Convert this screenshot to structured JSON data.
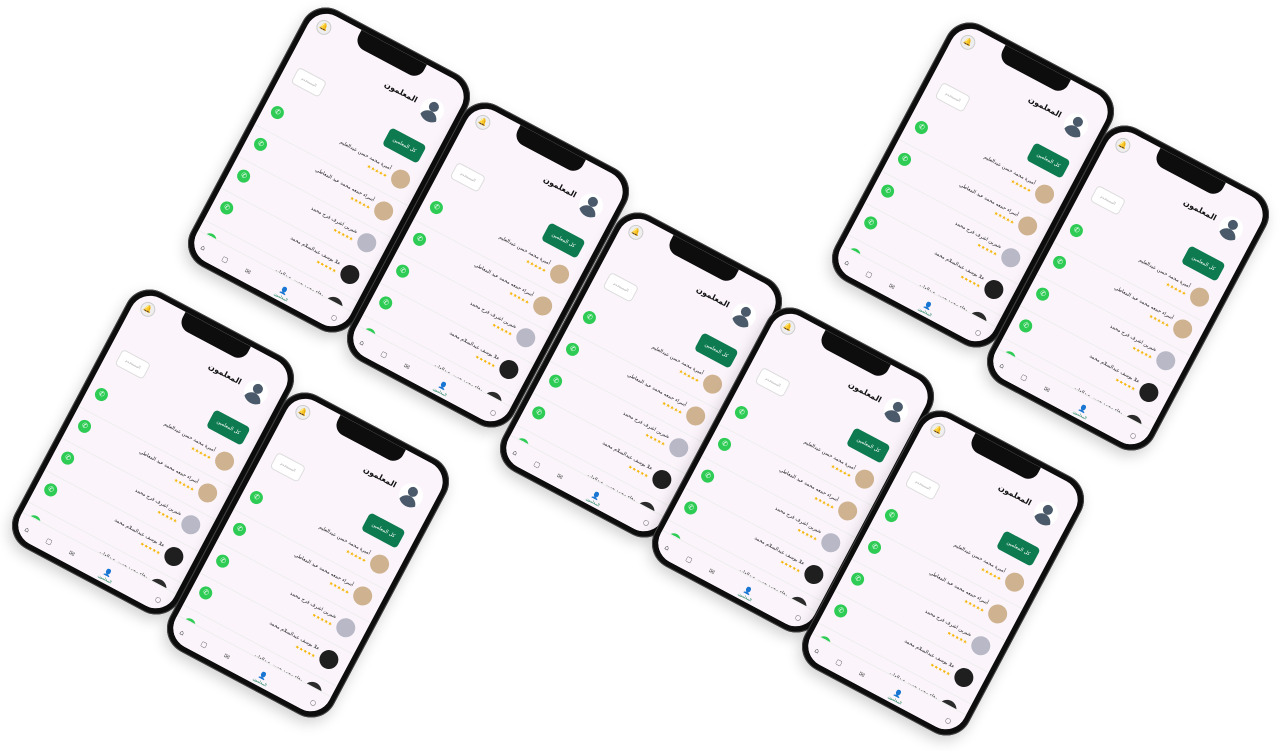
{
  "screen": {
    "title": "المعلمون",
    "search_placeholder": "المستخدم",
    "filter_button": "كل المعلمين",
    "teachers": [
      {
        "name": "أميرة محمد حسن عبدالعليم",
        "stars": "★★★★★"
      },
      {
        "name": "أسراء جمعه محمد عبد المعاطي",
        "stars": "★★★★★"
      },
      {
        "name": "شيرين اشرف فرج محمد",
        "stars": "★★★★★"
      },
      {
        "name": "علا يوسف عبدالسلام محمد",
        "stars": "★★★★★"
      },
      {
        "name": "وفاء محمد حسن عبدالعليم",
        "stars": "★★★★★"
      }
    ],
    "nav": {
      "active_label": "المعلمون",
      "icons": [
        "home-icon",
        "grid-icon",
        "chat-icon",
        "user-icon"
      ]
    }
  },
  "phones": [
    {
      "id": "p1"
    },
    {
      "id": "p2"
    },
    {
      "id": "p3"
    },
    {
      "id": "p4"
    },
    {
      "id": "p5"
    },
    {
      "id": "p6"
    },
    {
      "id": "p7"
    },
    {
      "id": "p8"
    },
    {
      "id": "p9"
    },
    {
      "id": "p10"
    }
  ]
}
